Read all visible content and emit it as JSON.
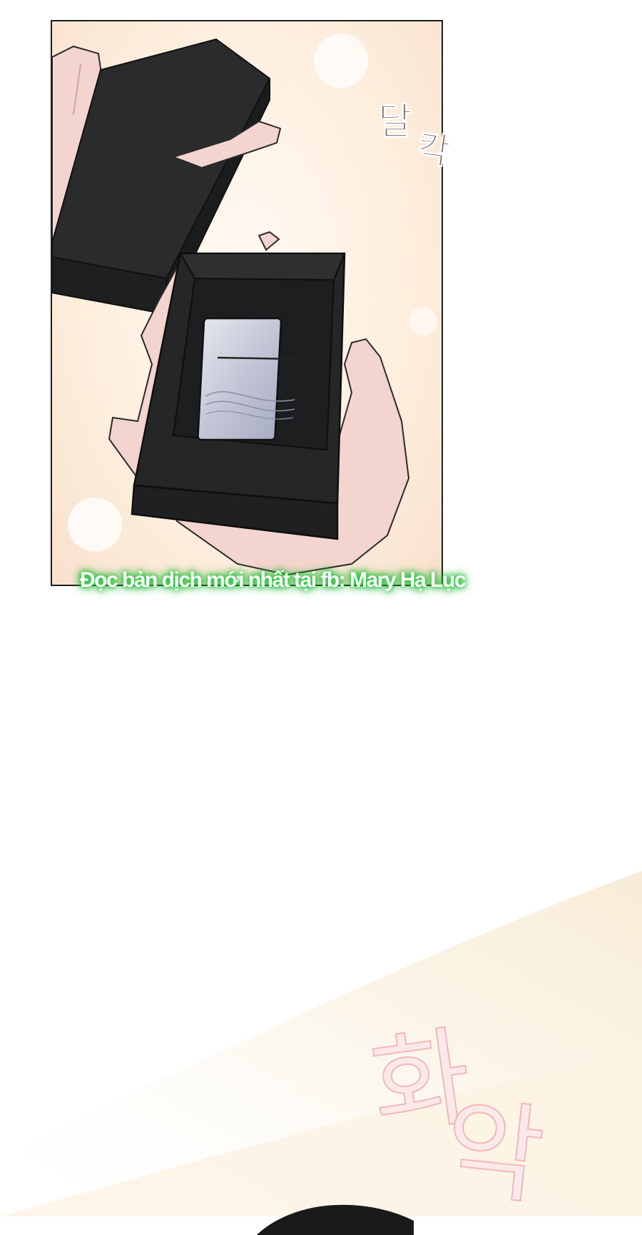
{
  "panel": {
    "sfx_top": [
      "달",
      "칵"
    ],
    "object": "lighter-in-gift-box"
  },
  "caption": "Đọc bản dịch mới nhất tại fb: Mary Hạ Lục",
  "sfx_bottom": [
    "화",
    "악"
  ],
  "colors": {
    "panel_bg": "#fdeedd",
    "box": "#262728",
    "skin": "#f4d4cf",
    "caption_glow": "#1fd13a",
    "sfx_pink": "#f2b7b9"
  }
}
